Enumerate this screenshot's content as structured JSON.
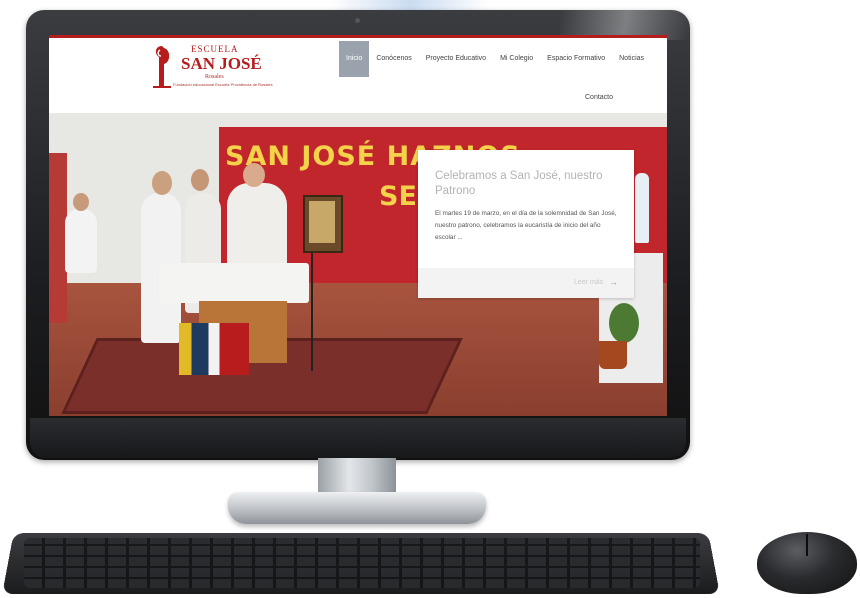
{
  "site": {
    "logo": {
      "escuela": "ESCUELA",
      "name": "SAN JOSÉ",
      "subtitle": "Rosales",
      "tagline": "Fundación educacional Escuela Providencia de Rosales"
    },
    "nav": [
      {
        "label": "Inicio",
        "active": true
      },
      {
        "label": "Conócenos",
        "active": false
      },
      {
        "label": "Proyecto Educativo",
        "active": false
      },
      {
        "label": "Mi Colegio",
        "active": false
      },
      {
        "label": "Espacio Formativo",
        "active": false
      },
      {
        "label": "Noticias",
        "active": false
      }
    ],
    "nav_contact": "Contacto",
    "hero": {
      "banner_line1": "SAN JOSÉ HAZNOS",
      "banner_line2": "SE"
    },
    "card": {
      "title": "Celebramos a San José, nuestro Patrono",
      "text": "El martes 19 de marzo, en el día de la solemnidad de San José, nuestro patrono, celebramos la eucaristía de inicio del año escolar ...",
      "more_label": "Leer más",
      "more_icon": "arrow-right-icon"
    }
  },
  "colors": {
    "brand_red": "#b71c1c",
    "nav_active_bg": "#9aa3ad",
    "banner_red": "#c0262b",
    "banner_text": "#f4d24a"
  }
}
